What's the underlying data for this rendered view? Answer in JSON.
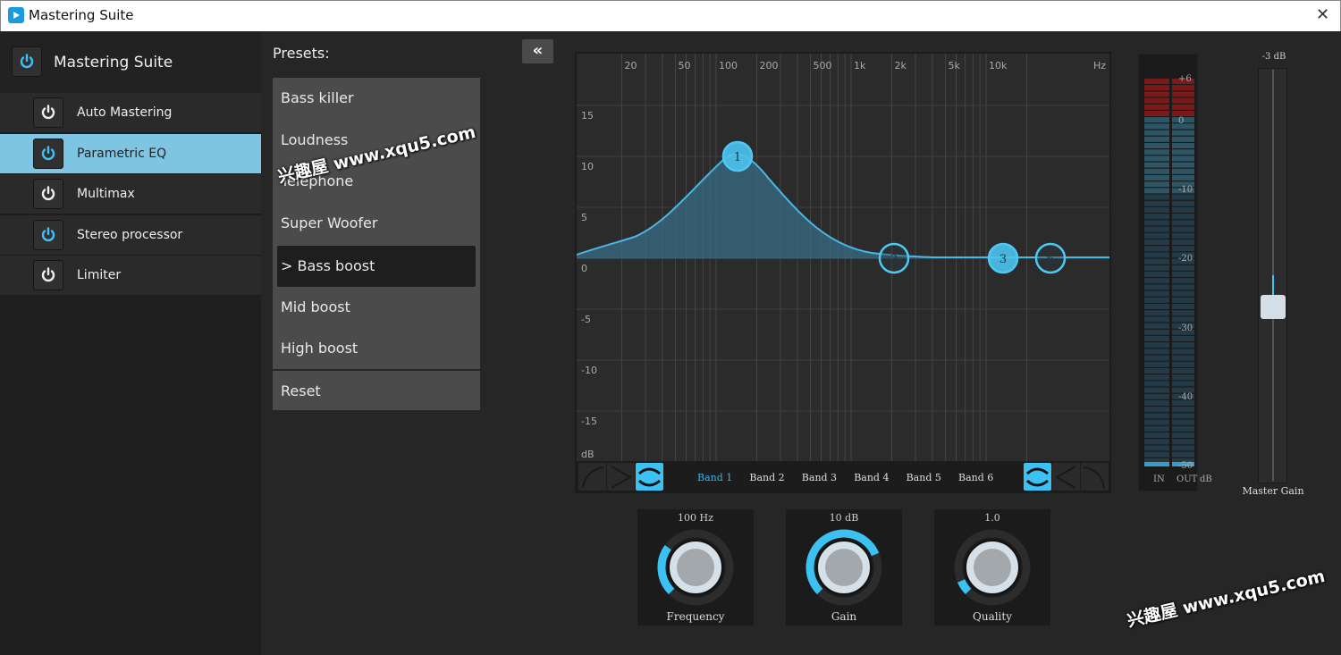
{
  "window": {
    "title": "Mastering Suite",
    "close": "✕"
  },
  "sidebar": {
    "title": "Mastering Suite",
    "items": [
      {
        "label": "Auto Mastering",
        "enabled": false,
        "selected": false
      },
      {
        "label": "Parametric EQ",
        "enabled": true,
        "selected": true
      },
      {
        "label": "Multimax",
        "enabled": false,
        "selected": false
      },
      {
        "label": "Stereo processor",
        "enabled": true,
        "selected": false
      },
      {
        "label": "Limiter",
        "enabled": false,
        "selected": false
      }
    ]
  },
  "presets": {
    "label": "Presets:",
    "items": [
      "Bass killer",
      "Loudness",
      "Telephone",
      "Super Woofer",
      "> Bass boost",
      "Mid boost",
      "High boost"
    ],
    "selected": 4,
    "reset": "Reset"
  },
  "collapse_label": "«",
  "eq": {
    "freq_labels": [
      {
        "f": 20,
        "t": "20"
      },
      {
        "f": 50,
        "t": "50"
      },
      {
        "f": 100,
        "t": "100"
      },
      {
        "f": 200,
        "t": "200"
      },
      {
        "f": 500,
        "t": "500"
      },
      {
        "f": 1000,
        "t": "1k"
      },
      {
        "f": 2000,
        "t": "2k"
      },
      {
        "f": 5000,
        "t": "5k"
      },
      {
        "f": 10000,
        "t": "10k"
      }
    ],
    "freq_unit": "Hz",
    "db_labels": [
      "15",
      "10",
      "5",
      "0",
      "-5",
      "-10",
      "-15"
    ],
    "db_unit": "dB",
    "nodes": [
      "1",
      "2",
      "3",
      "6"
    ],
    "bands": [
      "Band 1",
      "Band 2",
      "Band 3",
      "Band 4",
      "Band 5",
      "Band 6"
    ],
    "active_band": 0
  },
  "knobs": [
    {
      "value": "100 Hz",
      "label": "Frequency",
      "level": 0.3
    },
    {
      "value": "10 dB",
      "label": "Gain",
      "level": 0.75
    },
    {
      "value": "1.0",
      "label": "Quality",
      "level": 0.08
    }
  ],
  "meter": {
    "scale": [
      "+6",
      "0",
      "-10",
      "-20",
      "-30",
      "-40",
      "-50"
    ],
    "in": "IN",
    "out": "OUT",
    "unit": "dB"
  },
  "master_gain": {
    "value": "-3 dB",
    "label": "Master Gain"
  },
  "watermark": "兴趣屋 www.xqu5.com",
  "colors": {
    "accent": "#3cc2f2",
    "selected_item": "#7ec4e3"
  }
}
